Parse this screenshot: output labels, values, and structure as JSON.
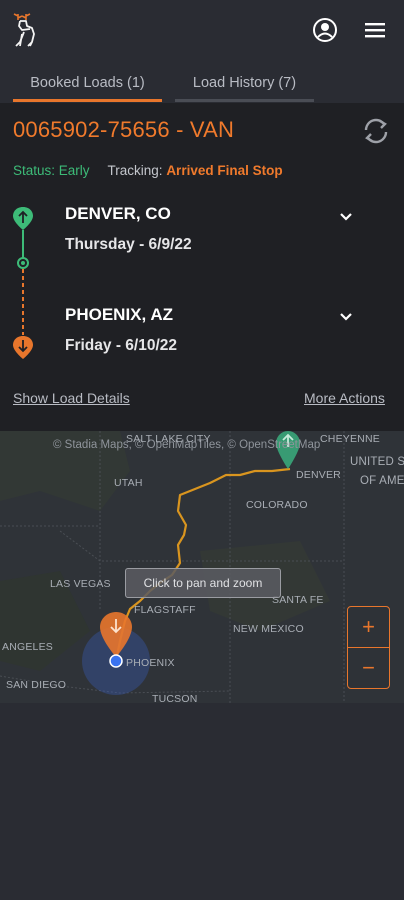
{
  "header": {
    "logo_icon": "deer-logo-icon",
    "profile_icon": "user-circle-icon",
    "menu_icon": "hamburger-menu-icon"
  },
  "tabs": [
    {
      "label": "Booked Loads (1)",
      "active": true
    },
    {
      "label": "Load History (7)",
      "active": false
    }
  ],
  "load": {
    "title": "0065902-75656 - VAN",
    "status_label": "Status: Early",
    "tracking_label": "Tracking:",
    "tracking_value": "Arrived Final Stop",
    "stops": [
      {
        "city": "DENVER, CO",
        "date": "Thursday - 6/9/22",
        "type": "pickup"
      },
      {
        "city": "PHOENIX, AZ",
        "date": "Friday - 6/10/22",
        "type": "dropoff"
      }
    ],
    "show_details": "Show Load Details",
    "more_actions": "More Actions"
  },
  "map": {
    "attribution": "© Stadia Maps, © OpenMapTiles, © OpenStreetMap",
    "pan_hint": "Click to pan and zoom",
    "zoom_in": "+",
    "zoom_out": "−",
    "labels": {
      "salt_lake": "SALT LAKE CITY",
      "cheyenne": "CHEYENNE",
      "denver": "DENVER",
      "united_states": "UNITED S",
      "of_ame": "OF AME",
      "utah": "UTAH",
      "colorado": "COLORADO",
      "las_vegas": "LAS VEGAS",
      "flagstaff": "FLAGSTAFF",
      "santa_fe": "SANTA FE",
      "new_mexico": "NEW MEXICO",
      "angeles": "ANGELES",
      "phoenix": "PHOENIX",
      "san_diego": "SAN DIEGO",
      "tucson": "TUCSON"
    },
    "route_color": "#d9951f"
  },
  "colors": {
    "accent": "#e8762c",
    "green": "#3dbb78",
    "card_bg": "#1f2024",
    "page_bg": "#2a2c33"
  }
}
